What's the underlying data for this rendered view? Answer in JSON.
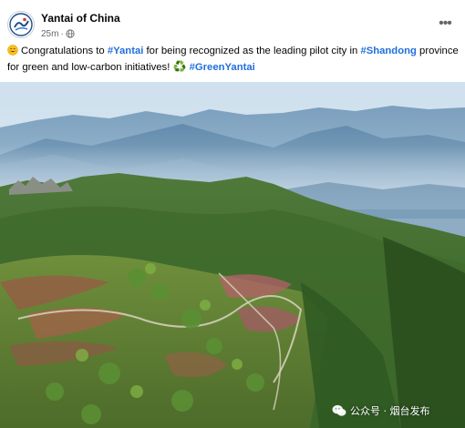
{
  "post": {
    "author": "Yantai of China",
    "time": "25m",
    "dot": "·",
    "privacy_icon": "globe-icon",
    "more_icon": "more-options-icon",
    "more_label": "•••"
  },
  "caption": {
    "emoji_start": "smiling-face-emoji",
    "text_1": "Congratulations to ",
    "tag_1": "#Yantai",
    "text_2": " for being recognized as the leading pilot city in ",
    "tag_2": "#Shandong",
    "text_3": " province for green and low-carbon initiatives! ",
    "emoji_recycle": "♻️",
    "tag_3": "#GreenYantai"
  },
  "photo": {
    "description_icon": "aerial-landscape-photo",
    "watermark": "公众号 · 烟台发布"
  },
  "colors": {
    "hashtag": "#216fdb",
    "secondary_text": "#65676b",
    "primary_text": "#050505"
  }
}
